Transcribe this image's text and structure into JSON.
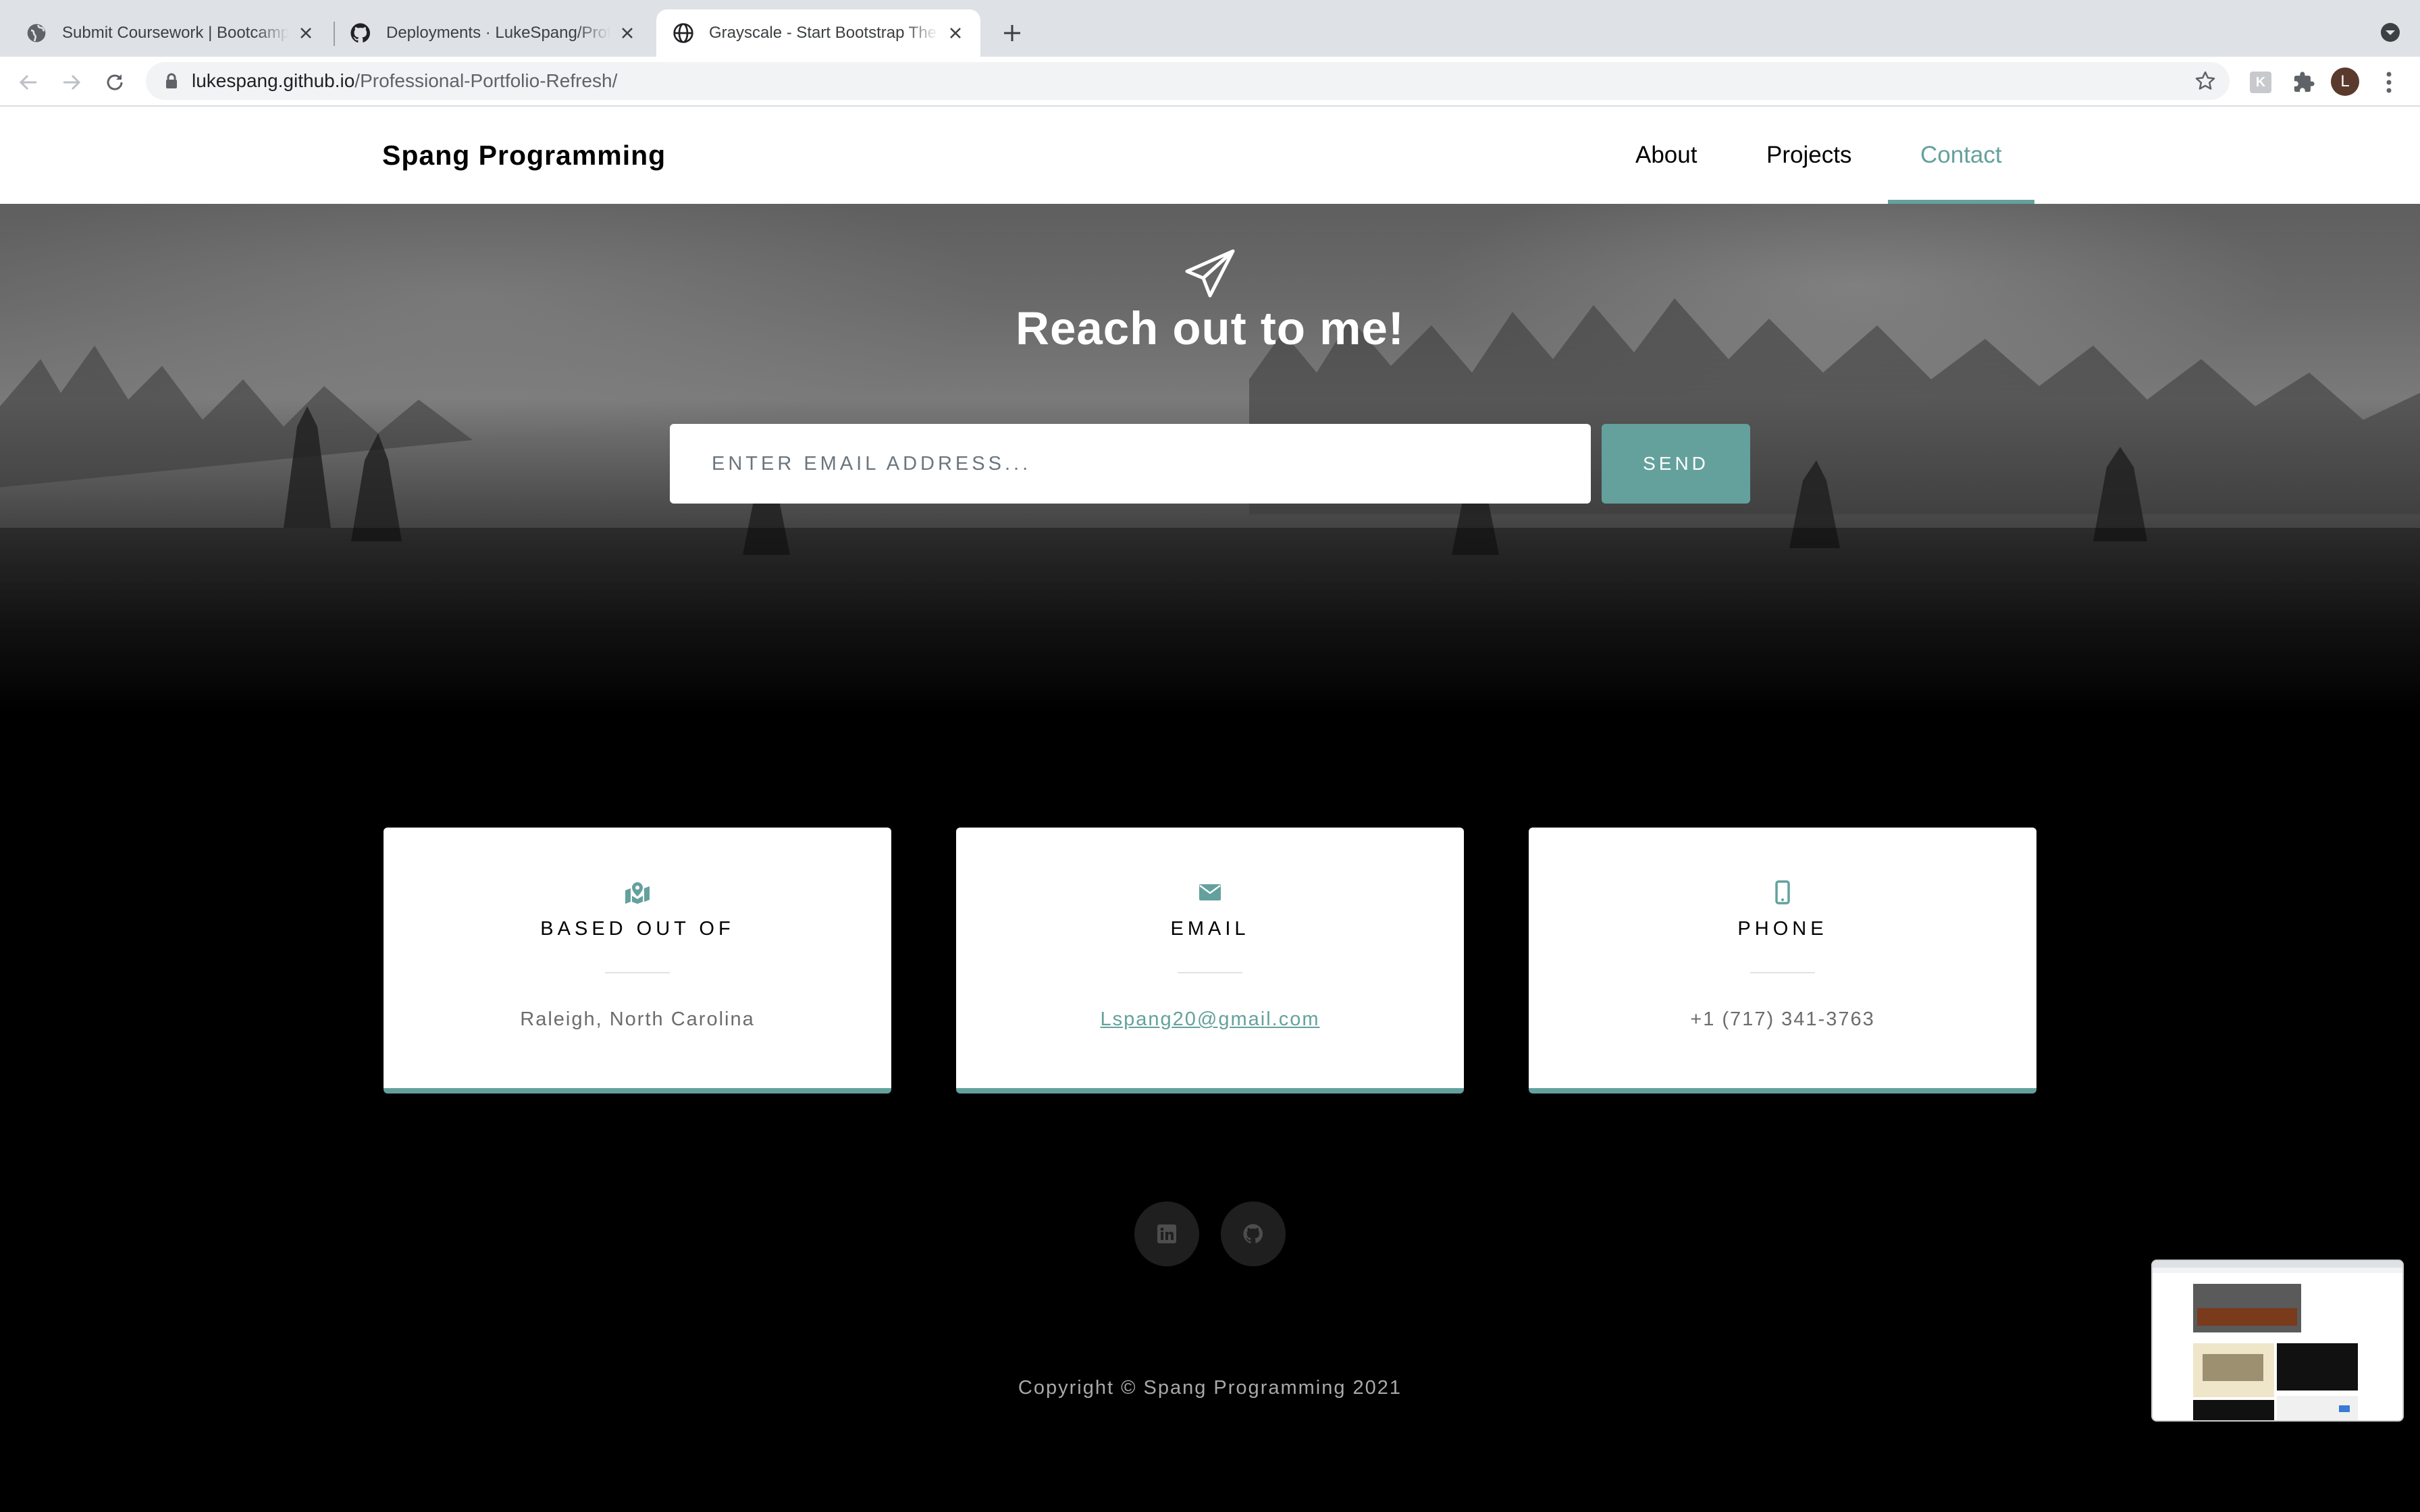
{
  "browser": {
    "tabs": [
      {
        "title": "Submit Coursework | Bootcamp",
        "icon": "globe-icon"
      },
      {
        "title": "Deployments · LukeSpang/Professional-Portfolio",
        "icon": "github-icon"
      },
      {
        "title": "Grayscale - Start Bootstrap Theme",
        "icon": "globe-icon"
      }
    ],
    "url": {
      "host": "lukespang.github.io",
      "path": "/Professional-Portfolio-Refresh/"
    },
    "extension_letter": "K",
    "avatar_letter": "L"
  },
  "nav": {
    "brand": "Spang Programming",
    "links": [
      "About",
      "Projects",
      "Contact"
    ],
    "active": "Contact"
  },
  "hero": {
    "title": "Reach out to me!",
    "email_placeholder": "ENTER EMAIL ADDRESS...",
    "send_label": "SEND"
  },
  "cards": [
    {
      "icon": "map-marked-icon",
      "title": "BASED OUT OF",
      "value": "Raleigh, North Carolina"
    },
    {
      "icon": "envelope-icon",
      "title": "EMAIL",
      "value": "Lspang20@gmail.com"
    },
    {
      "icon": "mobile-phone-icon",
      "title": "PHONE",
      "value": "+1 (717) 341-3763"
    }
  ],
  "social": [
    "linkedin-icon",
    "github-icon"
  ],
  "footer": {
    "copyright": "Copyright © Spang Programming 2021"
  },
  "colors": {
    "accent": "#64a19d",
    "tabbar": "#dee1e6",
    "background": "#000000"
  }
}
